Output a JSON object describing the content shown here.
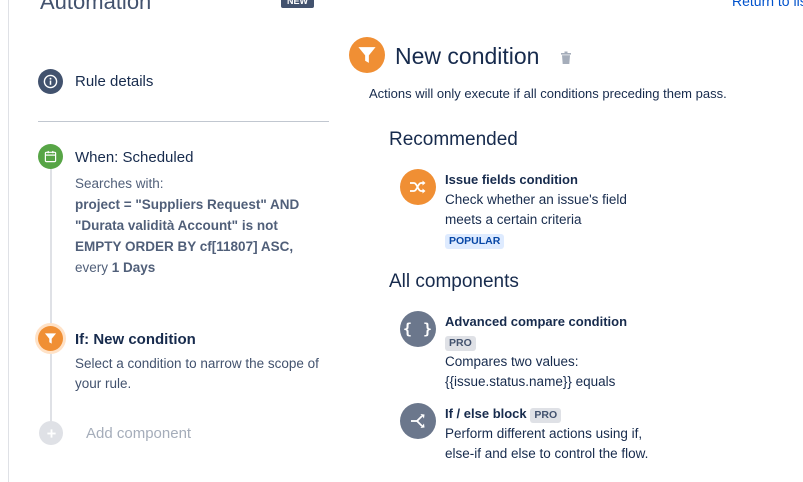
{
  "header": {
    "title": "Automation",
    "new_badge": "NEW",
    "return_link": "Return to lis"
  },
  "sidebar": {
    "rule_details": "Rule details",
    "trigger": {
      "title": "When: Scheduled",
      "searches_with": "Searches with:",
      "query": "project = \"Suppliers Request\" AND \"Durata validità Account\" is not EMPTY ORDER BY cf[11807] ASC,",
      "every_prefix": "every",
      "every_value": "1 Days"
    },
    "condition_step": {
      "title": "If: New condition",
      "description": "Select a condition to narrow the scope of your rule."
    },
    "add_component": "Add component"
  },
  "main": {
    "title": "New condition",
    "subtitle": "Actions will only execute if all conditions preceding them pass.",
    "recommended_heading": "Recommended",
    "recommended": [
      {
        "name": "Issue fields condition",
        "description": "Check whether an issue's field meets a certain criteria",
        "badge": "POPULAR",
        "icon": "shuffle-icon"
      }
    ],
    "all_components_heading": "All components",
    "components": [
      {
        "name": "Advanced compare condition",
        "badge": "PRO",
        "description": "Compares two values: {{issue.status.name}} equals",
        "icon": "braces-icon"
      },
      {
        "name": "If / else block",
        "badge": "PRO",
        "description": "Perform different actions using if, else-if and else to control the flow.",
        "icon": "branch-icon"
      }
    ]
  },
  "colors": {
    "accent_orange": "#f08f34",
    "trigger_green": "#57a546",
    "dark_gray": "#42526e",
    "component_gray": "#6b778c",
    "link_blue": "#0052cc"
  }
}
